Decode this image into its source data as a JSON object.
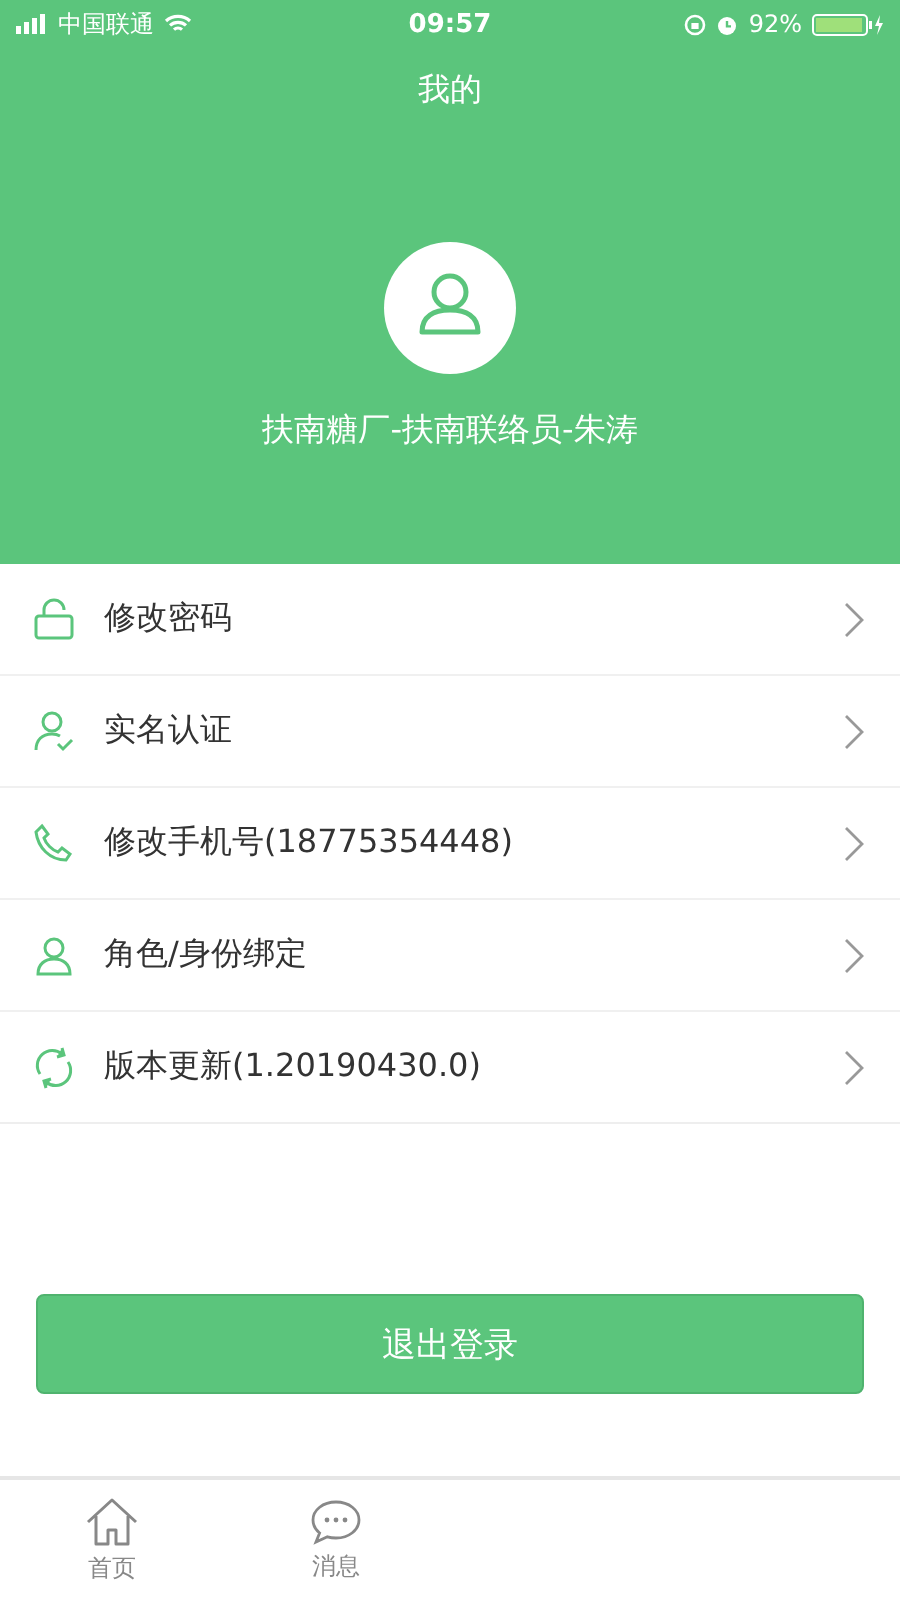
{
  "status_bar": {
    "carrier": "中国联通",
    "time": "09:57",
    "battery": "92%"
  },
  "header": {
    "title": "我的",
    "user_name": "扶南糖厂-扶南联络员-朱涛"
  },
  "menu": [
    {
      "kind": "lock",
      "label": "修改密码"
    },
    {
      "kind": "verify",
      "label": "实名认证"
    },
    {
      "kind": "phone",
      "label": "修改手机号(18775354448)"
    },
    {
      "kind": "person",
      "label": "角色/身份绑定"
    },
    {
      "kind": "refresh",
      "label": "版本更新(1.20190430.0)"
    }
  ],
  "logout_button": "退出登录",
  "tab_bar": [
    {
      "kind": "home",
      "label": "首页",
      "selected": false
    },
    {
      "kind": "message",
      "label": "消息",
      "selected": false
    }
  ]
}
